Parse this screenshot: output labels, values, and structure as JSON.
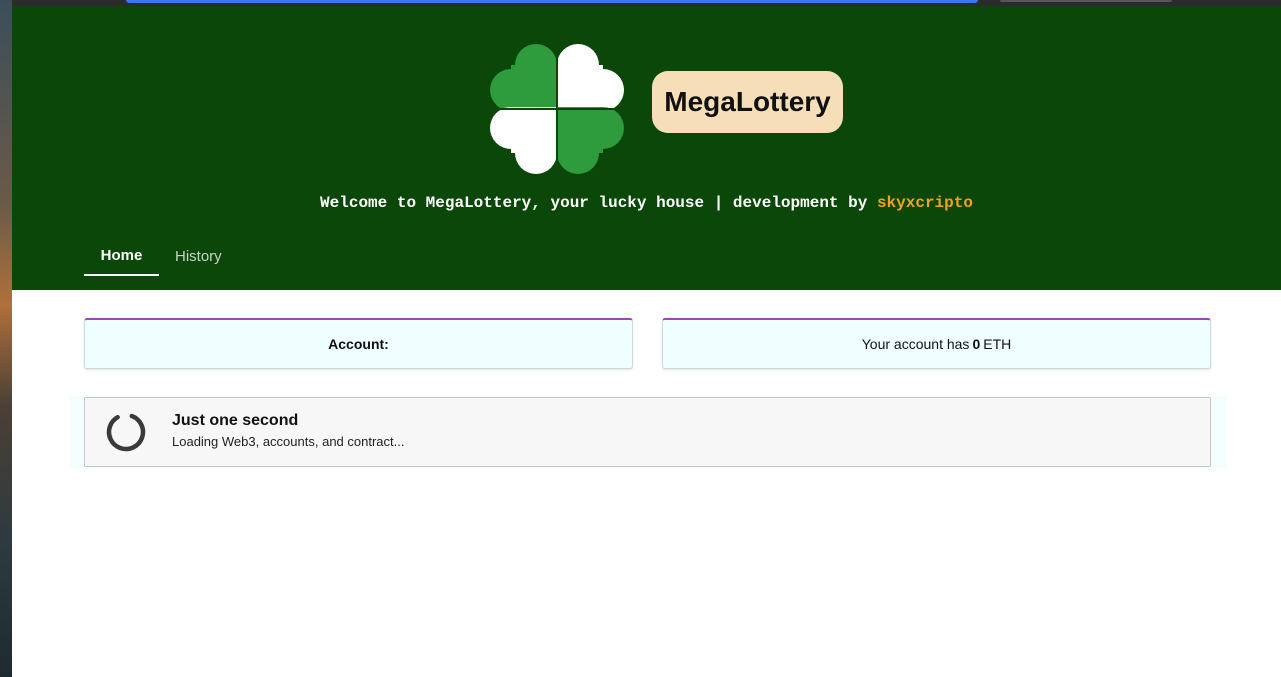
{
  "app": {
    "title": "MegaLottery",
    "welcome_prefix": "Welcome to MegaLottery, your lucky house | development by ",
    "developer": "skyxcripto"
  },
  "nav": {
    "tabs": [
      {
        "label": "Home",
        "active": true
      },
      {
        "label": "History",
        "active": false
      }
    ]
  },
  "account_card": {
    "label": "Account:"
  },
  "balance_card": {
    "prefix": "Your account has",
    "amount": "0",
    "unit": "ETH"
  },
  "loading": {
    "title": "Just one second",
    "message": "Loading Web3, accounts, and contract..."
  },
  "icons": {
    "logo": "four-leaf-clover-icon",
    "spinner": "loading-spinner-icon"
  },
  "colors": {
    "header_bg": "#0a4708",
    "title_pill_bg": "#f6dfb8",
    "developer_accent": "#f3a21b",
    "card_bg": "#effefe",
    "card_top_border": "#a044b8",
    "clover_green": "#2e9c3c"
  }
}
